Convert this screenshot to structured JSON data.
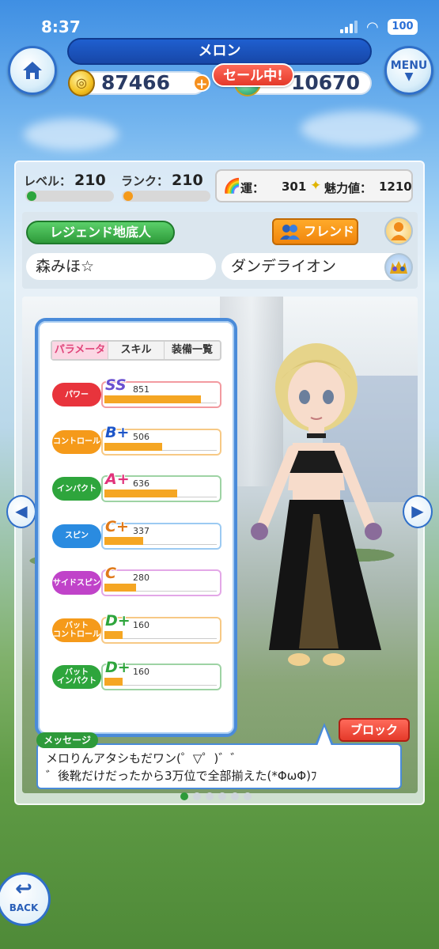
{
  "status_bar": {
    "time": "8:37",
    "battery": "100"
  },
  "header": {
    "title": "メロン",
    "menu_label": "MENU",
    "coins": "87466",
    "gems": "10670",
    "sale_badge": "セール中!"
  },
  "player": {
    "level_label": "レベル：",
    "level": "210",
    "rank_label": "ランク：",
    "rank": "210",
    "luck_label": "運：",
    "luck": "301",
    "charm_label": "魅力値：",
    "charm": "1210",
    "title_badge": "レジェンド地底人",
    "friend_button": "フレンド",
    "name": "森みほ☆",
    "guild": "ダンデライオン",
    "level_progress": 0.05,
    "rank_progress": 0.05
  },
  "params": {
    "tabs": [
      "パラメータ",
      "スキル",
      "装備一覧"
    ],
    "active_tab": 0,
    "rows": [
      {
        "label": "パワー",
        "grade": "SS",
        "value": "851",
        "fill": 0.85,
        "label_color": "#e8343c",
        "box_color": "#f29aa0",
        "grade_color": "#6a4fd0"
      },
      {
        "label": "コントロール",
        "grade": "B+",
        "value": "506",
        "fill": 0.51,
        "label_color": "#f59a1a",
        "box_color": "#f7c985",
        "grade_color": "#1e56c9"
      },
      {
        "label": "インパクト",
        "grade": "A+",
        "value": "636",
        "fill": 0.64,
        "label_color": "#2ea53c",
        "box_color": "#9ed3a4",
        "grade_color": "#e0327a"
      },
      {
        "label": "スピン",
        "grade": "C+",
        "value": "337",
        "fill": 0.34,
        "label_color": "#2a8be0",
        "box_color": "#9ccaf2",
        "grade_color": "#e07a1a"
      },
      {
        "label": "サイドスピン",
        "grade": "C",
        "value": "280",
        "fill": 0.28,
        "label_color": "#c043c9",
        "box_color": "#e3a7e7",
        "grade_color": "#e07a1a"
      },
      {
        "label": "バット\nコントロール",
        "grade": "D+",
        "value": "160",
        "fill": 0.16,
        "label_color": "#f59a1a",
        "box_color": "#f7c985",
        "grade_color": "#2ea53c"
      },
      {
        "label": "バット\nインパクト",
        "grade": "D+",
        "value": "160",
        "fill": 0.16,
        "label_color": "#2ea53c",
        "box_color": "#9ed3a4",
        "grade_color": "#2ea53c"
      }
    ]
  },
  "message": {
    "label": "メッセージ",
    "line1": "メロりんアタシもだワン(゜▽゜)゛゛",
    "line2": "゛後靴だけだったから3万位で全部揃えた(*ΦωΦ)ﾌ",
    "block_button": "ブロック"
  },
  "pager": {
    "count": 6,
    "active": 0
  },
  "back_label": "BACK"
}
